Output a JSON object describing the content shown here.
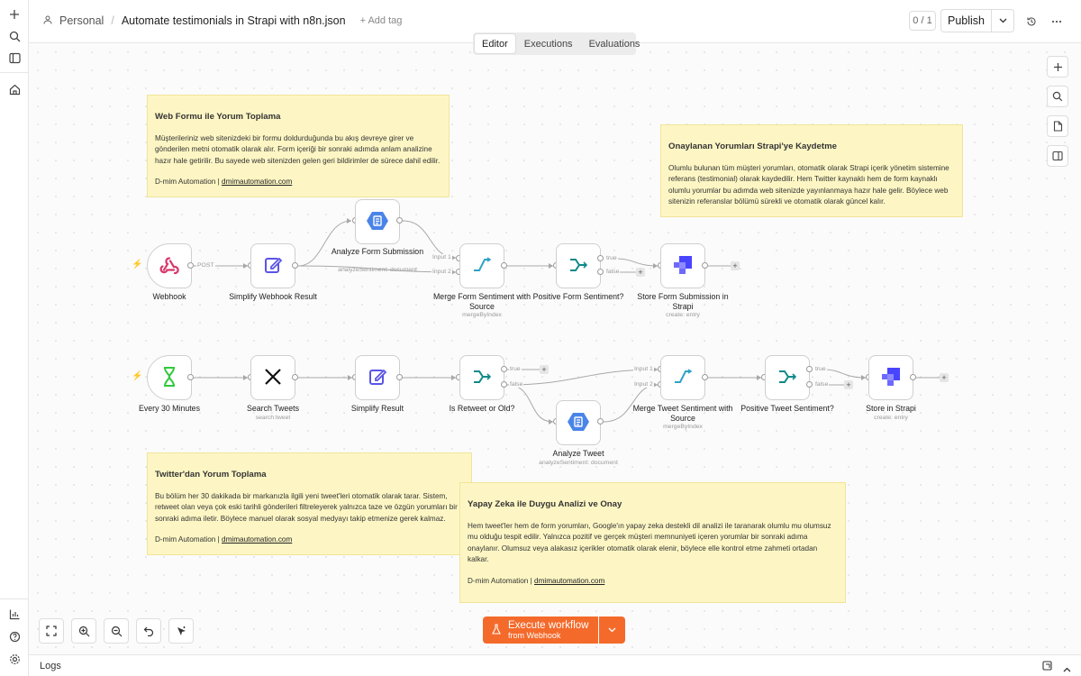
{
  "header": {
    "project": "Personal",
    "workflow_name": "Automate testimonials in Strapi with n8n.json",
    "add_tag": "+ Add tag",
    "counter": "0 / 1",
    "publish": "Publish"
  },
  "tabs": [
    {
      "label": "Editor",
      "active": true
    },
    {
      "label": "Executions",
      "active": false
    },
    {
      "label": "Evaluations",
      "active": false
    }
  ],
  "notes": {
    "web_form": {
      "title": "Web Formu ile Yorum Toplama",
      "body": "Müşterileriniz web sitenizdeki bir formu doldurduğunda bu akış devreye girer ve gönderilen metni otomatik olarak alır. Form içeriği bir sonraki adımda anlam analizine hazır hale getirilir. Bu sayede web sitenizden gelen geri bildirimler de sürece dahil edilir.",
      "sig_prefix": "D-mim Automation | ",
      "sig_link": "dmimautomation.com"
    },
    "strapi": {
      "title": "Onaylanan Yorumları Strapi'ye Kaydetme",
      "body": "Olumlu bulunan tüm müşteri yorumları, otomatik olarak Strapi içerik yönetim sistemine referans (testimonial) olarak kaydedilir. Hem Twitter kaynaklı hem de form kaynaklı olumlu yorumlar bu adımda web sitenizde yayınlanmaya hazır hale gelir. Böylece web sitenizin referanslar bölümü sürekli ve otomatik olarak güncel kalır."
    },
    "twitter": {
      "title": "Twitter'dan Yorum Toplama",
      "body": "Bu bölüm her 30 dakikada bir markanızla ilgili yeni tweet'leri otomatik olarak tarar. Sistem, retweet olan veya çok eski tarihli gönderileri filtreleyerek yalnızca taze ve özgün yorumları bir sonraki adıma iletir. Böylece manuel olarak sosyal medyayı takip etmenize gerek kalmaz.",
      "sig_prefix": "D-mim Automation | ",
      "sig_link": "dmimautomation.com"
    },
    "ai": {
      "title": "Yapay Zeka ile Duygu Analizi ve Onay",
      "body": "Hem tweet'ler hem de form yorumları, Google'ın yapay zeka destekli dil analizi ile taranarak olumlu mu olumsuz mu olduğu tespit edilir. Yalnızca pozitif ve gerçek müşteri memnuniyeti içeren yorumlar bir sonraki adıma onaylanır. Olumsuz veya alakasız içerikler otomatik olarak elenir, böylece elle kontrol etme zahmeti ortadan kalkar.",
      "sig_prefix": "D-mim Automation | ",
      "sig_link": "dmimautomation.com"
    }
  },
  "nodes": {
    "webhook": {
      "label": "Webhook",
      "icon": "webhook-icon",
      "out_label": "POST"
    },
    "simplify_webhook": {
      "label": "Simplify Webhook Result",
      "icon": "edit-icon"
    },
    "analyze_form": {
      "label": "Analyze Form Submission",
      "sub": "analyzeSentiment: document",
      "icon": "google-nl-icon"
    },
    "merge_form": {
      "label": "Merge Form Sentiment with Source",
      "sub": "mergeByIndex",
      "icon": "merge-icon",
      "in1": "Input 1",
      "in2": "Input 2"
    },
    "positive_form": {
      "label": "Positive Form Sentiment?",
      "icon": "if-icon",
      "out_true": "true",
      "out_false": "false"
    },
    "store_form": {
      "label": "Store Form Submission in Strapi",
      "sub": "create: entry",
      "icon": "strapi-icon"
    },
    "every30": {
      "label": "Every 30 Minutes",
      "icon": "hourglass-icon"
    },
    "search_tweets": {
      "label": "Search Tweets",
      "sub": "search:tweet",
      "icon": "x-icon"
    },
    "simplify_result": {
      "label": "Simplify Result",
      "icon": "edit-icon"
    },
    "is_retweet": {
      "label": "Is Retweet or Old?",
      "icon": "if-icon",
      "out_true": "true",
      "out_false": "false"
    },
    "analyze_tweet": {
      "label": "Analyze Tweet",
      "sub": "analyzeSentiment: document",
      "icon": "google-nl-icon"
    },
    "merge_tweet": {
      "label": "Merge Tweet Sentiment with Source",
      "sub": "mergeByIndex",
      "icon": "merge-icon",
      "in1": "Input 1",
      "in2": "Input 2"
    },
    "positive_tweet": {
      "label": "Positive Tweet Sentiment?",
      "icon": "if-icon",
      "out_true": "true",
      "out_false": "false"
    },
    "store_strapi": {
      "label": "Store in Strapi",
      "sub": "create: entry",
      "icon": "strapi-icon"
    }
  },
  "execute": {
    "label": "Execute workflow",
    "sub": "from Webhook"
  },
  "logs": {
    "label": "Logs"
  },
  "colors": {
    "accent": "#f46a2b",
    "note_bg": "#fdf6c4",
    "edge": "#a8a8a8",
    "trigger_bolt": "#f08a3e"
  }
}
